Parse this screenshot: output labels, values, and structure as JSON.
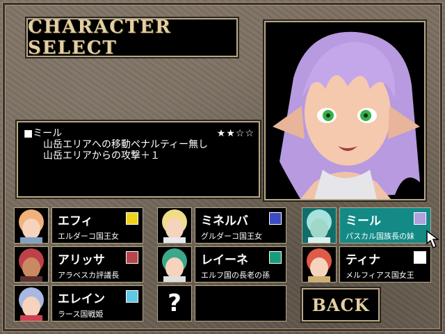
{
  "title": "CHARACTER SELECT",
  "selected": {
    "name": "■ミール",
    "stars": "★★☆☆",
    "rating": 2,
    "rating_max": 4,
    "line1": "山岳エリアへの移動ペナルティー無し",
    "line2": "山岳エリアからの攻撃＋１"
  },
  "characters": [
    {
      "name": "エフィ",
      "title": "エルダーコ国王女",
      "color": "#f0d21c",
      "hair": "#f0b27a"
    },
    {
      "name": "アリッサ",
      "title": "アラベスカ評議長",
      "color": "#b8454c",
      "hair": "#c0404a"
    },
    {
      "name": "エレイン",
      "title": "ラース国戦姫",
      "color": "#5ec8e6",
      "hair": "#a8b8e0"
    },
    {
      "name": "ミネルバ",
      "title": "グルダーコ国王女",
      "color": "#3d4bc2",
      "hair": "#f2dc8a"
    },
    {
      "name": "レイーネ",
      "title": "エルフ国の長老の孫",
      "color": "#199c7c",
      "hair": "#3aa88a"
    },
    {
      "name": "ミール",
      "title": "パスカル国族長の妹",
      "color": "#b0a0de",
      "hair": "#a8e2dc"
    },
    {
      "name": "ティナ",
      "title": "メルフィアス国女王",
      "color": "#ffffff",
      "hair": "#e05a48"
    }
  ],
  "unknown": "?",
  "back_label": "BACK",
  "icons": {
    "cursor": "pointer-arrow-icon"
  }
}
